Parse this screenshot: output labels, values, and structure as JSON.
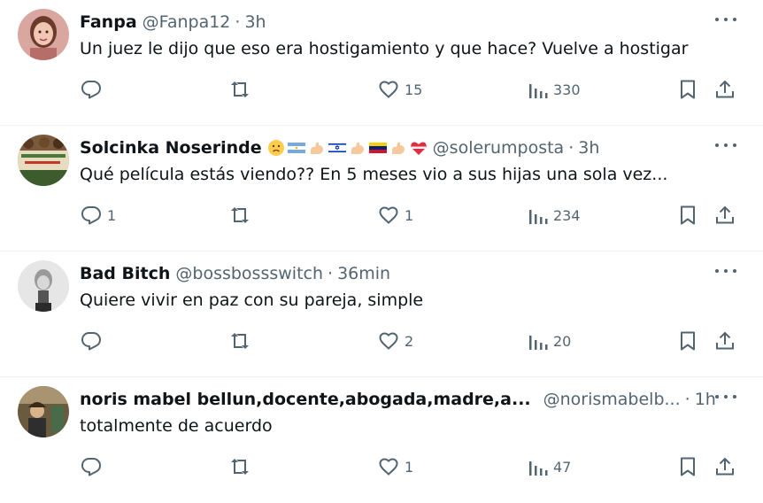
{
  "colors": {
    "text": "#0f1419",
    "secondary": "#536471",
    "divider": "#eff3f4",
    "background": "#ffffff"
  },
  "tweets": [
    {
      "name": "Fanpa",
      "handle": "@Fanpa12",
      "separator": "·",
      "time": "3h",
      "text": "Un juez le dijo que eso era hostigamiento y que hace? Vuelve a hostigar",
      "replies": "",
      "retweets": "",
      "likes": "15",
      "views": "330",
      "emojis": []
    },
    {
      "name": "Solcinka Noserinde",
      "handle": "@solerumposta",
      "separator": "·",
      "time": "3h",
      "text": "Qué película estás viendo?? En 5 meses vio a sus hijas una sola vez...",
      "replies": "1",
      "retweets": "",
      "likes": "1",
      "views": "234",
      "emojis": [
        "frowning-face-icon",
        "argentina-flag-icon",
        "flexed-biceps-icon",
        "israel-flag-icon",
        "flexed-biceps-icon",
        "venezuela-flag-icon",
        "flexed-biceps-icon",
        "heart-with-ribbon-icon"
      ]
    },
    {
      "name": "Bad Bitch",
      "handle": "@bossbossswitch",
      "separator": "·",
      "time": "36min",
      "text": "Quiere vivir en paz con su pareja, simple",
      "replies": "",
      "retweets": "",
      "likes": "2",
      "views": "20",
      "emojis": []
    },
    {
      "name": "noris mabel bellun,docente,abogada,madre,a...",
      "handle": "@norismabelb...",
      "separator": "·",
      "time": "1h",
      "text": "totalmente de acuerdo",
      "replies": "",
      "retweets": "",
      "likes": "1",
      "views": "47",
      "emojis": []
    }
  ],
  "icons": {
    "reply": "reply-icon",
    "retweet": "retweet-icon",
    "like": "heart-icon",
    "views": "views-icon",
    "bookmark": "bookmark-icon",
    "share": "share-icon",
    "more": "more-options-icon"
  }
}
